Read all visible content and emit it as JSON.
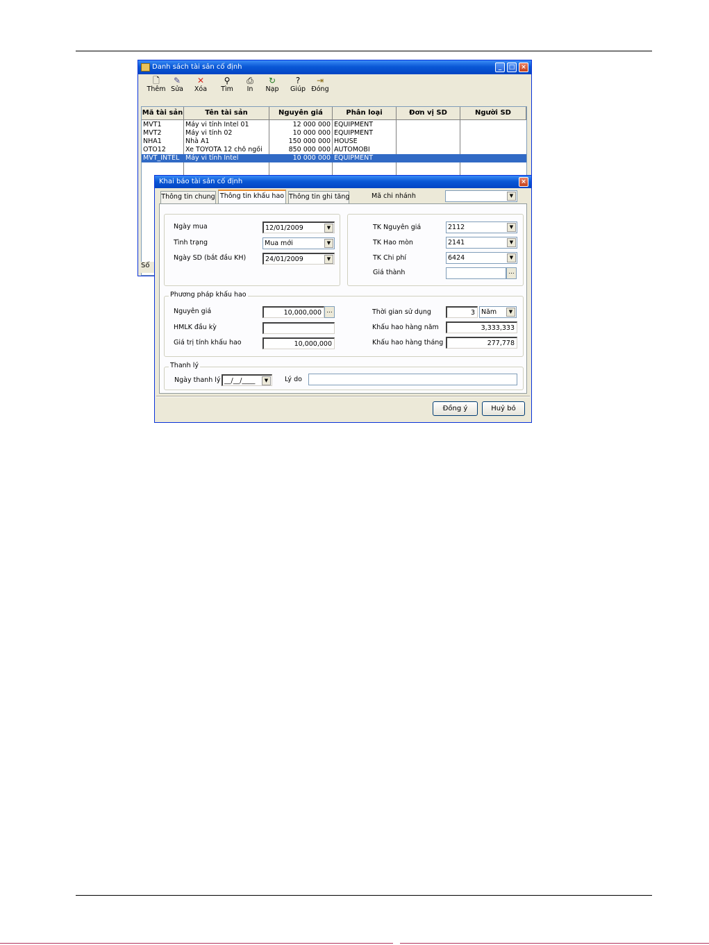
{
  "list_window": {
    "title": "Danh sách tài sản cố định",
    "toolbar": [
      {
        "label": "Thêm",
        "icon": "new-document-icon"
      },
      {
        "label": "Sửa",
        "icon": "edit-icon"
      },
      {
        "label": "Xóa",
        "icon": "delete-icon"
      },
      {
        "label": "Tìm",
        "icon": "binoculars-icon"
      },
      {
        "label": "In",
        "icon": "printer-icon"
      },
      {
        "label": "Nạp",
        "icon": "refresh-icon"
      },
      {
        "label": "Giúp",
        "icon": "help-icon"
      },
      {
        "label": "Đóng",
        "icon": "exit-icon"
      }
    ],
    "columns": [
      "Mã tài sản",
      "Tên tài sản",
      "Nguyên giá",
      "Phân loại",
      "Đơn vị SD",
      "Người SD"
    ],
    "rows": [
      [
        "MVT1",
        "Máy vi tính Intel 01",
        "12 000 000",
        "EQUIPMENT",
        "",
        ""
      ],
      [
        "MVT2",
        "Máy vi tính 02",
        "10 000 000",
        "EQUIPMENT",
        "",
        ""
      ],
      [
        "NHA1",
        "Nhà A1",
        "150 000 000",
        "HOUSE",
        "",
        ""
      ],
      [
        "OTO12",
        "Xe TOYOTA 12 chỗ ngồi",
        "850 000 000",
        "AUTOMOBI",
        "",
        ""
      ],
      [
        "MVT_INTEL",
        "Máy vi tính Intel",
        "10 000 000",
        "EQUIPMENT",
        "",
        ""
      ]
    ],
    "selected_row": 4,
    "status_text": "Số"
  },
  "dialog": {
    "title": "Khai báo tài sản cố định",
    "tabs": [
      "Thông tin chung",
      "Thông tin khấu hao",
      "Thông tin ghi tăng"
    ],
    "active_tab": 1,
    "branch": {
      "label": "Mã chi nhánh",
      "value": ""
    },
    "left_group": {
      "purchase_date": {
        "label": "Ngày mua",
        "value": "12/01/2009"
      },
      "status": {
        "label": "Tình trạng",
        "value": "Mua mới"
      },
      "start_date": {
        "label": "Ngày SD (bắt đầu KH)",
        "value": "24/01/2009"
      }
    },
    "right_group": {
      "acct_cost": {
        "label": "TK Nguyên giá",
        "value": "2112"
      },
      "acct_depr": {
        "label": "TK Hao mòn",
        "value": "2141"
      },
      "acct_expense": {
        "label": "TK Chi phí",
        "value": "6424"
      },
      "cost_price": {
        "label": "Giá thành",
        "value": ""
      }
    },
    "depreciation": {
      "title": "Phương pháp khấu hao",
      "original_cost": {
        "label": "Nguyên giá",
        "value": "10,000,000"
      },
      "opening_accum": {
        "label": "HMLK đầu kỳ",
        "value": ""
      },
      "depr_base": {
        "label": "Giá trị tính khấu hao",
        "value": "10,000,000"
      },
      "useful_life": {
        "label": "Thời gian sử dụng",
        "value": "3",
        "unit": "Năm"
      },
      "annual": {
        "label": "Khấu hao hàng năm",
        "value": "3,333,333"
      },
      "monthly": {
        "label": "Khấu hao hàng tháng",
        "value": "277,778"
      }
    },
    "disposal": {
      "title": "Thanh lý",
      "date": {
        "label": "Ngày thanh lý",
        "value": "__/__/____"
      },
      "reason": {
        "label": "Lý do",
        "value": ""
      }
    },
    "buttons": {
      "ok": "Đồng ý",
      "cancel": "Huỷ bỏ"
    }
  }
}
